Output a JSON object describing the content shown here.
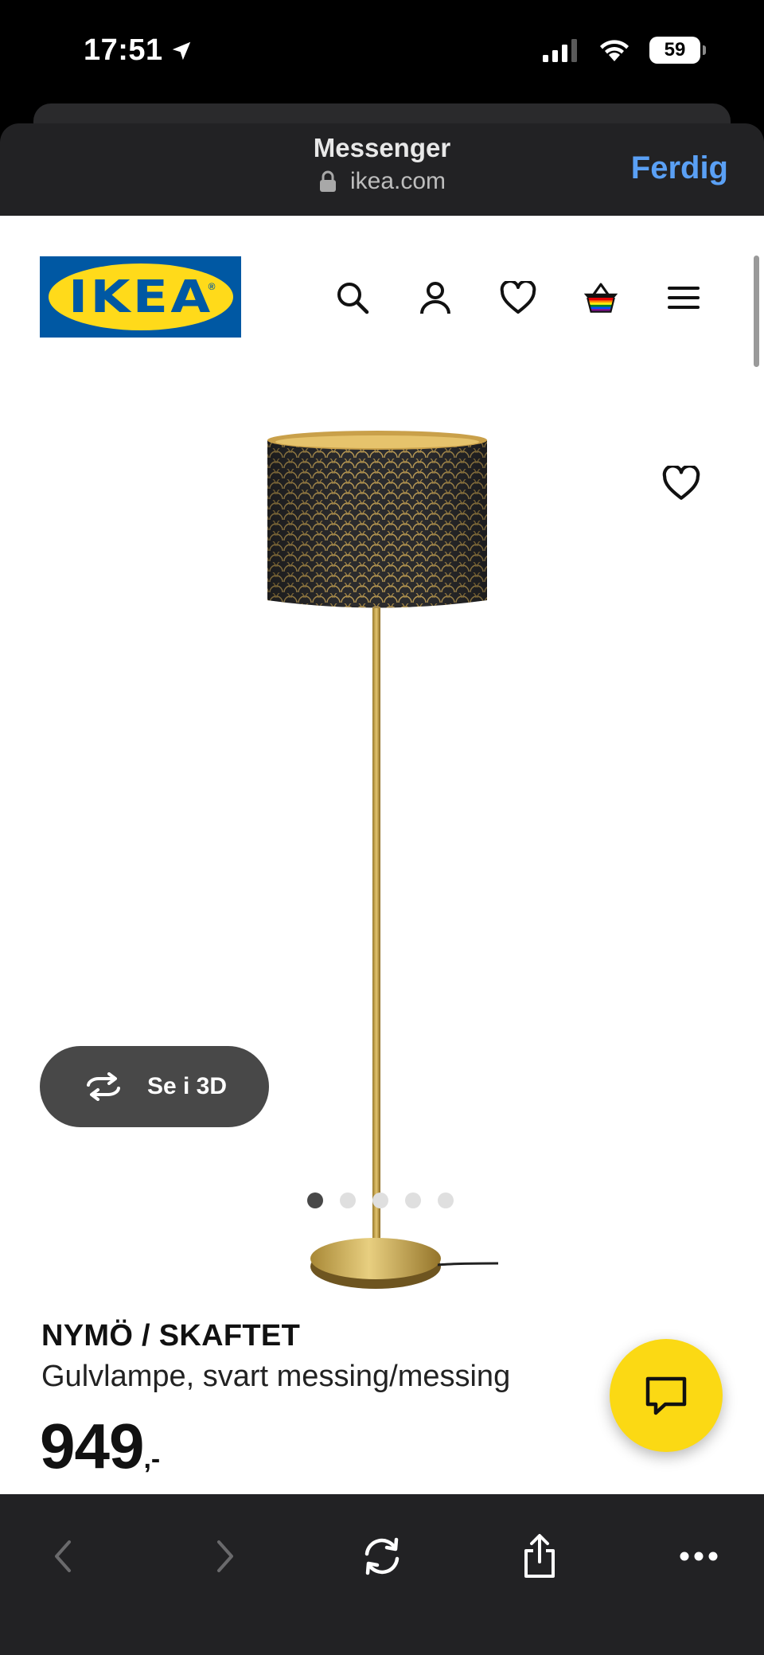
{
  "status_bar": {
    "time": "17:51",
    "battery": "59"
  },
  "browser": {
    "title": "Messenger",
    "url": "ikea.com",
    "done_label": "Ferdig"
  },
  "brand": {
    "logo_text": "IKEA",
    "logo_mark": "®",
    "colors": {
      "blue": "#0058a3",
      "yellow": "#ffda1a",
      "chat_yellow": "#fbd914"
    }
  },
  "header_icons": [
    "search-icon",
    "account-icon",
    "heart-icon",
    "shopping-bag-icon",
    "menu-icon"
  ],
  "product": {
    "view_3d_label": "Se i 3D",
    "gallery": {
      "count": 5,
      "active": 0
    },
    "name": "NYMÖ / SKAFTET",
    "description": "Gulvlampe, svart messing/messing",
    "price": "949",
    "price_suffix": ",-"
  },
  "toolbar_icons": [
    "back-icon",
    "forward-icon",
    "reload-icon",
    "share-icon",
    "more-icon"
  ]
}
